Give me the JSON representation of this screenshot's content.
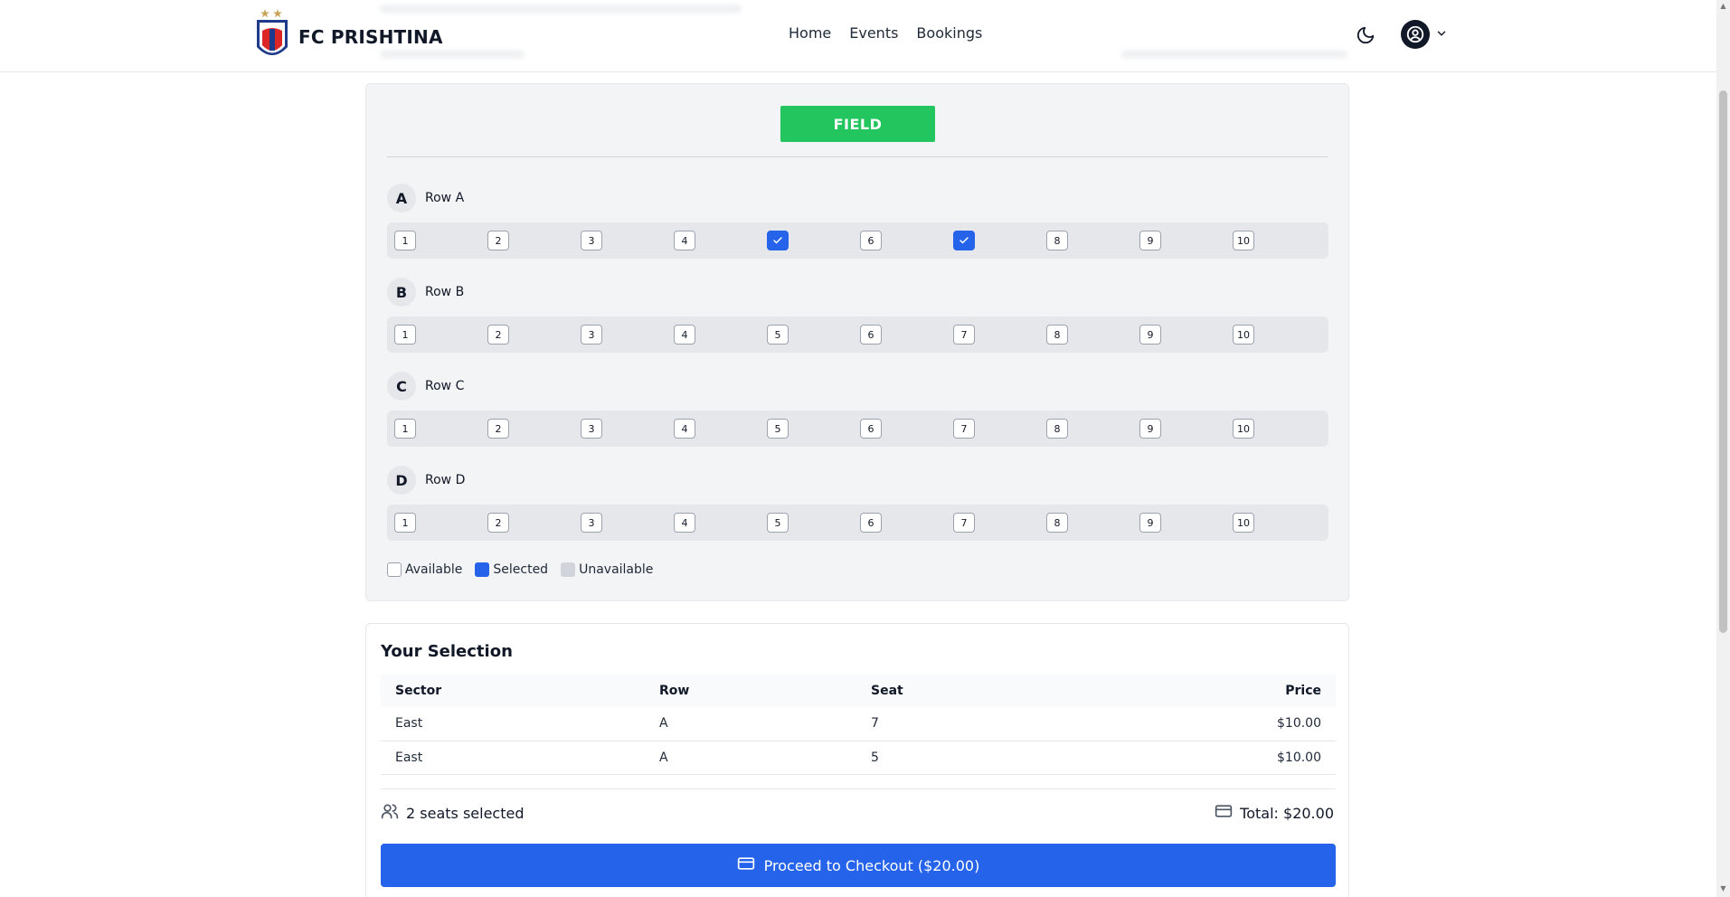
{
  "brand": {
    "name": "FC PRISHTINA",
    "logo_text": "FC PRISHTINA"
  },
  "nav": {
    "items": [
      {
        "label": "Home"
      },
      {
        "label": "Events"
      },
      {
        "label": "Bookings"
      }
    ]
  },
  "icons": {
    "theme": "moon-icon",
    "user": "user-circle-icon",
    "menu": "chevron-down-icon"
  },
  "seat_map": {
    "field_label": "FIELD",
    "rows": [
      {
        "letter": "A",
        "name": "Row A",
        "seats": [
          {
            "label": "1",
            "status": "available"
          },
          {
            "label": "2",
            "status": "available"
          },
          {
            "label": "3",
            "status": "available"
          },
          {
            "label": "4",
            "status": "available"
          },
          {
            "label": "5",
            "status": "selected"
          },
          {
            "label": "6",
            "status": "available"
          },
          {
            "label": "7",
            "status": "selected"
          },
          {
            "label": "8",
            "status": "available"
          },
          {
            "label": "9",
            "status": "available"
          },
          {
            "label": "10",
            "status": "available"
          }
        ]
      },
      {
        "letter": "B",
        "name": "Row B",
        "seats": [
          {
            "label": "1",
            "status": "available"
          },
          {
            "label": "2",
            "status": "available"
          },
          {
            "label": "3",
            "status": "available"
          },
          {
            "label": "4",
            "status": "available"
          },
          {
            "label": "5",
            "status": "available"
          },
          {
            "label": "6",
            "status": "available"
          },
          {
            "label": "7",
            "status": "available"
          },
          {
            "label": "8",
            "status": "available"
          },
          {
            "label": "9",
            "status": "available"
          },
          {
            "label": "10",
            "status": "available"
          }
        ]
      },
      {
        "letter": "C",
        "name": "Row C",
        "seats": [
          {
            "label": "1",
            "status": "available"
          },
          {
            "label": "2",
            "status": "available"
          },
          {
            "label": "3",
            "status": "available"
          },
          {
            "label": "4",
            "status": "available"
          },
          {
            "label": "5",
            "status": "available"
          },
          {
            "label": "6",
            "status": "available"
          },
          {
            "label": "7",
            "status": "available"
          },
          {
            "label": "8",
            "status": "available"
          },
          {
            "label": "9",
            "status": "available"
          },
          {
            "label": "10",
            "status": "available"
          }
        ]
      },
      {
        "letter": "D",
        "name": "Row D",
        "seats": [
          {
            "label": "1",
            "status": "available"
          },
          {
            "label": "2",
            "status": "available"
          },
          {
            "label": "3",
            "status": "available"
          },
          {
            "label": "4",
            "status": "available"
          },
          {
            "label": "5",
            "status": "available"
          },
          {
            "label": "6",
            "status": "available"
          },
          {
            "label": "7",
            "status": "available"
          },
          {
            "label": "8",
            "status": "available"
          },
          {
            "label": "9",
            "status": "available"
          },
          {
            "label": "10",
            "status": "available"
          }
        ]
      }
    ],
    "legend": {
      "available": "Available",
      "selected": "Selected",
      "unavailable": "Unavailable"
    }
  },
  "selection": {
    "title": "Your Selection",
    "columns": {
      "sector": "Sector",
      "row": "Row",
      "seat": "Seat",
      "price": "Price"
    },
    "items": [
      {
        "sector": "East",
        "row": "A",
        "seat": "7",
        "price": "$10.00"
      },
      {
        "sector": "East",
        "row": "A",
        "seat": "5",
        "price": "$10.00"
      }
    ],
    "seats_selected": "2 seats selected",
    "total": "Total: $20.00",
    "checkout_label": "Proceed to Checkout ($20.00)"
  },
  "colors": {
    "accent": "#2563eb",
    "field": "#22c55e",
    "seat_selected": "#2563eb",
    "seat_unavailable": "#d1d5db"
  }
}
